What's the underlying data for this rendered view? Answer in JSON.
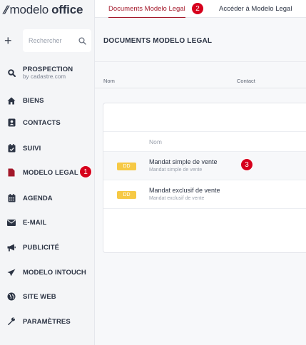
{
  "app": {
    "logo_word1": "modelo",
    "logo_word2": "office"
  },
  "sidebar": {
    "search_placeholder": "Rechercher",
    "items": [
      {
        "label": "PROSPECTION",
        "sub": "by cadastre.com",
        "icon": "search-icon"
      },
      {
        "label": "BIENS",
        "icon": "home-icon"
      },
      {
        "label": "CONTACTS",
        "icon": "contact-card-icon"
      },
      {
        "label": "SUIVI",
        "icon": "calendar-check-icon"
      },
      {
        "label": "MODELO LEGAL",
        "icon": "document-icon"
      },
      {
        "label": "AGENDA",
        "icon": "calendar-icon"
      },
      {
        "label": "E-MAIL",
        "icon": "envelope-icon"
      },
      {
        "label": "PUBLICITÉ",
        "icon": "megaphone-icon"
      },
      {
        "label": "MODELO INTOUCH",
        "icon": "paper-plane-icon"
      },
      {
        "label": "SITE WEB",
        "icon": "globe-icon"
      },
      {
        "label": "PARAMÈTRES",
        "icon": "wrench-icon"
      }
    ]
  },
  "tabs": [
    {
      "label": "Documents Modelo Legal",
      "active": true
    },
    {
      "label": "Accéder à Modelo Legal",
      "active": false
    }
  ],
  "main": {
    "title": "DOCUMENTS MODELO LEGAL",
    "filters": {
      "nom": "Nom",
      "contact": "Contact"
    },
    "table": {
      "column": "Nom",
      "rows": [
        {
          "tag": "DD",
          "title": "Mandat simple de vente",
          "subtitle": "Mandat simple de vente"
        },
        {
          "tag": "DD",
          "title": "Mandat exclusif de vente",
          "subtitle": "Mandat exclusif de vente"
        }
      ]
    }
  },
  "badges": {
    "one": "1",
    "two": "2",
    "three": "3"
  },
  "colors": {
    "accent": "#a3182a",
    "badge": "#d6001c",
    "tag": "#f6c945",
    "sidebar_bg": "#f4f5f7"
  }
}
